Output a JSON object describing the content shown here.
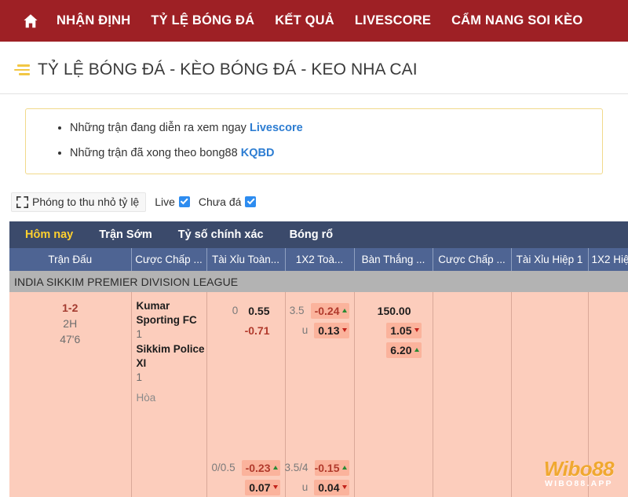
{
  "nav": {
    "home_icon": "home-icon",
    "items": [
      {
        "label": "NHẬN ĐỊNH"
      },
      {
        "label": "TỶ LỆ BÓNG ĐÁ"
      },
      {
        "label": "KẾT QUẢ"
      },
      {
        "label": "LIVESCORE"
      },
      {
        "label": "CẨM NANG SOI KÈO"
      }
    ]
  },
  "page": {
    "title": "TỶ LỆ BÓNG ĐÁ - KÈO BÓNG ĐÁ - KEO NHA CAI"
  },
  "notice": {
    "items": [
      {
        "text": "Những trận đang diễn ra xem ngay ",
        "link": "Livescore"
      },
      {
        "text": "Những trận đã xong theo bong88 ",
        "link": "KQBD"
      }
    ]
  },
  "toolbar": {
    "zoom_label": "Phóng to thu nhỏ tỷ lệ",
    "zoom_icon": "fullscreen-icon",
    "live_label": "Live",
    "live_checked": true,
    "upcoming_label": "Chưa đá",
    "upcoming_checked": true
  },
  "tabs": [
    {
      "label": "Hôm nay",
      "active": true
    },
    {
      "label": "Trận Sớm",
      "active": false
    },
    {
      "label": "Tỷ số chính xác",
      "active": false
    },
    {
      "label": "Bóng rổ",
      "active": false
    }
  ],
  "table": {
    "headers": [
      "Trận Đấu",
      "Cược Chấp ...",
      "Tài Xỉu Toàn...",
      "1X2 Toà...",
      "Bàn Thắng ...",
      "Cược Chấp ...",
      "Tài Xỉu Hiệp 1",
      "1X2 Hiệ"
    ],
    "league": "INDIA SIKKIM PREMIER DIVISION LEAGUE",
    "match": {
      "score": "1-2",
      "half": "2H",
      "minute": "47'6",
      "home_team": "Kumar Sporting FC",
      "home_num": "1",
      "away_team": "Sikkim Police XI",
      "away_num": "1",
      "draw_label": "Hòa",
      "handicap_ft": {
        "line": "0",
        "over_value": "0.55",
        "over_arrow": "none",
        "under_value": "-0.71",
        "under_arrow": "none"
      },
      "overunder_ft": {
        "line": "3.5",
        "over_value": "-0.24",
        "over_arrow": "up",
        "under_prefix": "u",
        "under_value": "0.13",
        "under_arrow": "down"
      },
      "x12_ft": {
        "home_value": "150.00",
        "home_arrow": "none",
        "draw_value": "1.05",
        "draw_arrow": "down",
        "away_value": "6.20",
        "away_arrow": "up"
      },
      "handicap_h1": {
        "line": "0/0.5",
        "over_value": "-0.23",
        "over_arrow": "up",
        "under_value": "0.07",
        "under_arrow": "down"
      },
      "overunder_h1": {
        "line": "3.5/4",
        "over_value": "-0.15",
        "over_arrow": "up",
        "under_prefix": "u",
        "under_value": "0.04",
        "under_arrow": "down"
      }
    }
  },
  "watermark": {
    "name": "Wibo88",
    "domain": "WIBO88.APP"
  },
  "colors": {
    "navbar": "#9e2025",
    "tabbar": "#3b4a6b",
    "header": "#4e6493",
    "row": "#fccdbc",
    "accent_yellow": "#ffd02e",
    "link": "#2d7dd2"
  }
}
